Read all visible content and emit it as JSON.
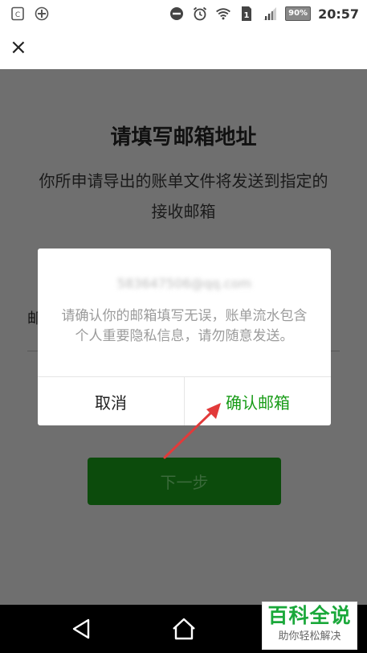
{
  "status_bar": {
    "battery": "90%",
    "time": "20:57",
    "sim_badge": "1",
    "icons": [
      "screenshot-icon",
      "vpn-icon",
      "dnd-icon",
      "alarm-icon",
      "wifi-icon",
      "sim-icon",
      "signal-icon",
      "battery-icon"
    ]
  },
  "header": {
    "close_glyph": "×"
  },
  "page": {
    "title": "请填写邮箱地址",
    "description": "你所申请导出的账单文件将发送到指定的接收邮箱",
    "field_label_partial": "邮",
    "next_button": "下一步"
  },
  "dialog": {
    "email": "583647506@qq.com",
    "message": "请确认你的邮箱填写无误，账单流水包含个人重要隐私信息，请勿随意发送。",
    "cancel": "取消",
    "confirm": "确认邮箱"
  },
  "watermark": {
    "main": "百科全说",
    "sub": "助你轻松解决"
  },
  "colors": {
    "overlay": "#6f6f6f",
    "accent_green": "#179b16",
    "next_button_bg": "#0c4b0c",
    "arrow_red": "#e23a3a"
  }
}
